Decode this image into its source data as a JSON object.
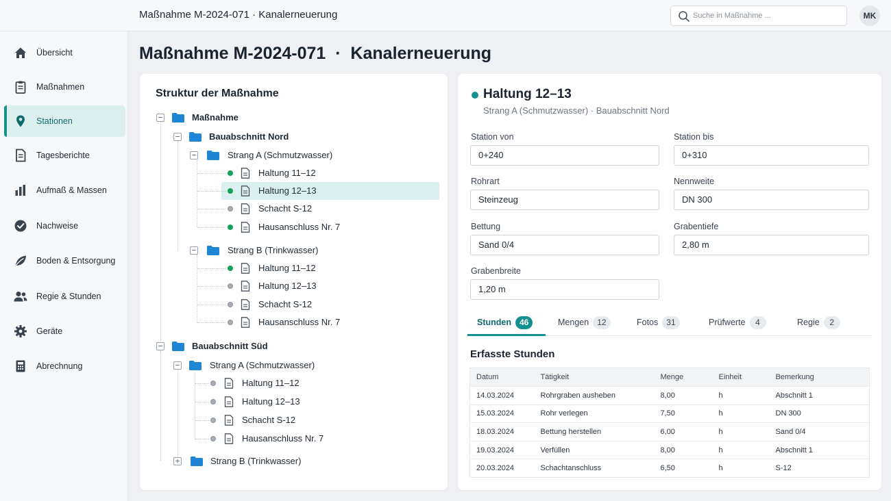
{
  "topbar": {
    "title": "Maßnahme M-2024-071 · Kanalerneuerung",
    "search_placeholder": "Suche in Maßnahme ...",
    "avatar_initials": "MK"
  },
  "sidebar": {
    "items": [
      {
        "label": "Übersicht",
        "icon": "home-icon"
      },
      {
        "label": "Maßnahmen",
        "icon": "clipboard-icon"
      },
      {
        "label": "Stationen",
        "icon": "map-pin-icon",
        "active": true
      },
      {
        "label": "Tagesberichte",
        "icon": "document-icon"
      },
      {
        "label": "Aufmaß & Massen",
        "icon": "bar-chart-icon"
      },
      {
        "label": "Nachweise",
        "icon": "check-circle-icon"
      },
      {
        "label": "Boden & Entsorgung",
        "icon": "leaf-icon"
      },
      {
        "label": "Regie & Stunden",
        "icon": "users-icon"
      },
      {
        "label": "Geräte",
        "icon": "gear-icon"
      },
      {
        "label": "Abrechnung",
        "icon": "calculator-icon"
      }
    ]
  },
  "page_title": "Maßnahme M-2024-071  ·  Kanalerneuerung",
  "tree": {
    "title": "Struktur der Maßnahme",
    "root": "Maßnahme",
    "nord": {
      "label": "Bauabschnitt Nord",
      "strang_a": {
        "label": "Strang A (Schmutzwasser)",
        "items": [
          "Haltung 11–12",
          "Haltung 12–13",
          "Schacht S-12",
          "Hausanschluss Nr. 7"
        ]
      },
      "strang_b": {
        "label": "Strang B (Trinkwasser)",
        "items": [
          "Haltung 11–12",
          "Haltung 12–13",
          "Schacht S-12",
          "Hausanschluss Nr. 7"
        ]
      }
    },
    "sued": {
      "label": "Bauabschnitt Süd",
      "strang_a": {
        "label": "Strang A (Schmutzwasser)",
        "items": [
          "Haltung 11–12",
          "Haltung 12–13",
          "Schacht S-12",
          "Hausanschluss Nr. 7"
        ]
      },
      "strang_b": {
        "label": "Strang B (Trinkwasser)"
      }
    }
  },
  "detail": {
    "title": "Haltung 12–13",
    "subtitle": "Strang A (Schmutzwasser) · Bauabschnitt Nord",
    "fields": {
      "station_von": {
        "label": "Station von",
        "value": "0+240"
      },
      "station_bis": {
        "label": "Station bis",
        "value": "0+310"
      },
      "rohrart": {
        "label": "Rohrart",
        "value": "Steinzeug"
      },
      "nennweite": {
        "label": "Nennweite",
        "value": "DN 300"
      },
      "bettung": {
        "label": "Bettung",
        "value": "Sand 0/4"
      },
      "grabentiefe": {
        "label": "Grabentiefe",
        "value": "2,80 m"
      },
      "grabenbreite": {
        "label": "Grabenbreite",
        "value": "1,20 m"
      }
    },
    "tabs": [
      {
        "label": "Stunden",
        "count": "46",
        "active": true
      },
      {
        "label": "Mengen",
        "count": "12"
      },
      {
        "label": "Fotos",
        "count": "31"
      },
      {
        "label": "Prüfwerte",
        "count": "4"
      },
      {
        "label": "Regie",
        "count": "2"
      }
    ],
    "section_title": "Erfasste Stunden",
    "table": {
      "headers": [
        "Datum",
        "Tätigkeit",
        "Menge",
        "Einheit",
        "Bemerkung"
      ],
      "rows": [
        [
          "14.03.2024",
          "Rohrgraben ausheben",
          "8,00",
          "h",
          "Abschnitt 1"
        ],
        [
          "15.03.2024",
          "Rohr verlegen",
          "7,50",
          "h",
          "DN 300"
        ],
        [
          "18.03.2024",
          "Bettung herstellen",
          "6,00",
          "h",
          "Sand 0/4"
        ],
        [
          "19.03.2024",
          "Verfüllen",
          "8,00",
          "h",
          "Abschnitt 1"
        ],
        [
          "20.03.2024",
          "Schachtanschluss",
          "6,50",
          "h",
          "S-12"
        ]
      ]
    }
  },
  "colors": {
    "accent": "#13908f",
    "active_bg": "#dcefef",
    "folder": "#1f86d6",
    "status_green": "#13a05a",
    "status_grey": "#a7adb4"
  }
}
